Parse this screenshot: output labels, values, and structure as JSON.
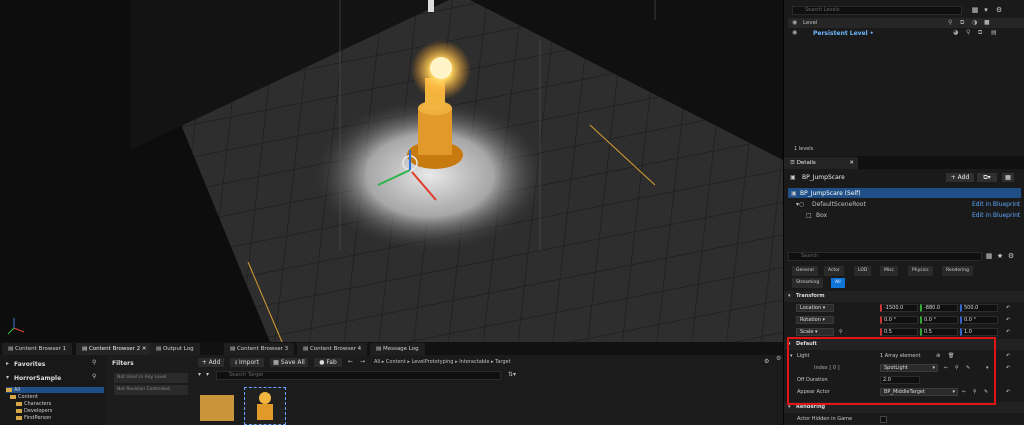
{
  "outliner": {
    "search_placeholder": "Search Levels",
    "column_level": "Level",
    "persistent_level": "Persistent Level •",
    "levels_count": "1 levels"
  },
  "details": {
    "tab_label": "Details",
    "actor_name": "BP_JumpScare",
    "add_label": "+ Add",
    "components": {
      "self": "BP_JumpScare (Self)",
      "scene_root": "DefaultSceneRoot",
      "box": "Box",
      "edit_link_1": "Edit in Blueprint",
      "edit_link_2": "Edit in Blueprint"
    },
    "search_placeholder": "Search",
    "filters": [
      "General",
      "Actor",
      "LOD",
      "Misc",
      "Physics",
      "Rendering",
      "Streaming",
      "All"
    ],
    "transform": {
      "header": "Transform",
      "location_label": "Location",
      "location": [
        "-1500.0",
        "-880.0",
        "500.0"
      ],
      "rotation_label": "Rotation",
      "rotation": [
        "0.0 °",
        "0.0 °",
        "0.0 °"
      ],
      "scale_label": "Scale",
      "scale": [
        "0.5",
        "0.5",
        "1.0"
      ]
    },
    "default_section": {
      "header": "Default",
      "light_label": "Light",
      "light_count": "1 Array element",
      "index_label": "Index [ 0 ]",
      "index_value": "SpotLight",
      "off_duration_label": "Off Duration",
      "off_duration_value": "2.0",
      "appear_actor_label": "Appear Actor",
      "appear_actor_value": "BP_MiddleTarget"
    },
    "rendering": {
      "header": "Rendering",
      "hidden_label": "Actor Hidden in Game"
    }
  },
  "bottom_tabs": [
    "Content Browser 1",
    "Content Browser 2",
    "Output Log",
    "Content Browser 3",
    "Content Browser 4",
    "Message Log"
  ],
  "content_browser": {
    "favorites": "Favorites",
    "project": "HorrorSample",
    "tree": [
      "All",
      "Content",
      "Characters",
      "Developers",
      "FirstPerson"
    ],
    "filters_label": "Filters",
    "filter_items": [
      "Not Used In Any Level",
      "Not Revision Controlled"
    ],
    "add_label": "+ Add",
    "import_label": "Import",
    "save_all_label": "Save All",
    "fab_label": "Fab",
    "breadcrumb": [
      "All",
      "Content",
      "LevelPrototyping",
      "Interactable",
      "Target"
    ],
    "search_placeholder": "Search Target"
  },
  "colors": {
    "accent": "#0f74d8",
    "highlight_red": "#e01515",
    "selection": "#1f4f86",
    "glow": "#ffd560"
  }
}
